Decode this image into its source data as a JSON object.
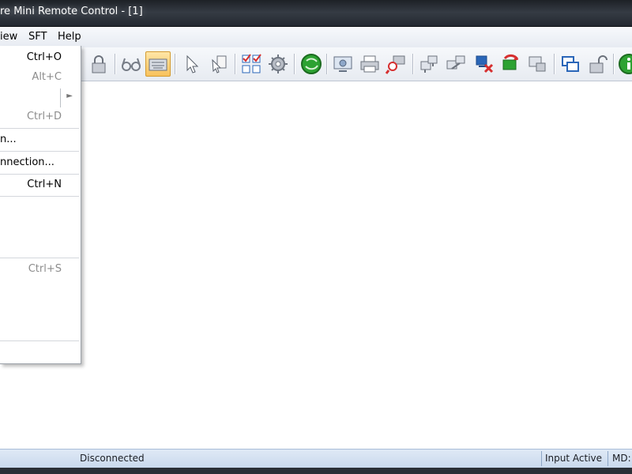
{
  "window": {
    "title": "re Mini Remote Control - [1]"
  },
  "menubar": {
    "items": [
      {
        "label": "iew"
      },
      {
        "label": "SFT"
      },
      {
        "label": "Help"
      }
    ]
  },
  "dropdown": {
    "items": [
      {
        "label": "",
        "shortcut": "Ctrl+O",
        "enabled": true
      },
      {
        "label": "",
        "shortcut": "Alt+C",
        "enabled": false
      },
      {
        "label": "",
        "shortcut": "",
        "enabled": true,
        "submenu": true,
        "submenu_glyph": "►"
      },
      {
        "label": "",
        "shortcut": "Ctrl+D",
        "enabled": false
      },
      {
        "label": "n...",
        "shortcut": "",
        "enabled": true
      },
      {
        "label": "nnection...",
        "shortcut": "",
        "enabled": true
      },
      {
        "label": "",
        "shortcut": "Ctrl+N",
        "enabled": true
      },
      {
        "label": "",
        "shortcut": "",
        "enabled": true
      },
      {
        "label": "",
        "shortcut": "Ctrl+S",
        "enabled": false
      },
      {
        "label": "",
        "shortcut": "",
        "enabled": true
      }
    ]
  },
  "toolbar": {
    "buttons": [
      {
        "icon": "lock-icon",
        "active": false
      },
      {
        "icon": "glasses-icon",
        "active": false
      },
      {
        "icon": "keyboard-icon",
        "active": true
      },
      {
        "icon": "mouse-pointer-icon",
        "active": false
      },
      {
        "icon": "pointer-document-icon",
        "active": false
      },
      {
        "icon": "checklist-grid-icon",
        "active": false
      },
      {
        "icon": "gear-icon",
        "active": false
      },
      {
        "icon": "green-globe-icon",
        "active": false
      },
      {
        "icon": "screen-capture-icon",
        "active": false
      },
      {
        "icon": "printer-icon",
        "active": false
      },
      {
        "icon": "zoom-printer-icon",
        "active": false
      },
      {
        "icon": "network-icon",
        "active": false
      },
      {
        "icon": "computer-link-icon",
        "active": false
      },
      {
        "icon": "disconnect-computer-icon",
        "active": false
      },
      {
        "icon": "refresh-network-icon",
        "active": false
      },
      {
        "icon": "transfer-computer-icon",
        "active": false
      },
      {
        "icon": "windows-icon",
        "active": false
      },
      {
        "icon": "unlock-icon",
        "active": false
      },
      {
        "icon": "info-icon",
        "active": false
      }
    ],
    "colors": {
      "active_bg": "#f8c25c",
      "green": "#2da232",
      "blue": "#2a66b8",
      "red": "#d62f2f"
    }
  },
  "statusbar": {
    "connection": "Disconnected",
    "input": "Input Active",
    "extra": "MD:"
  }
}
